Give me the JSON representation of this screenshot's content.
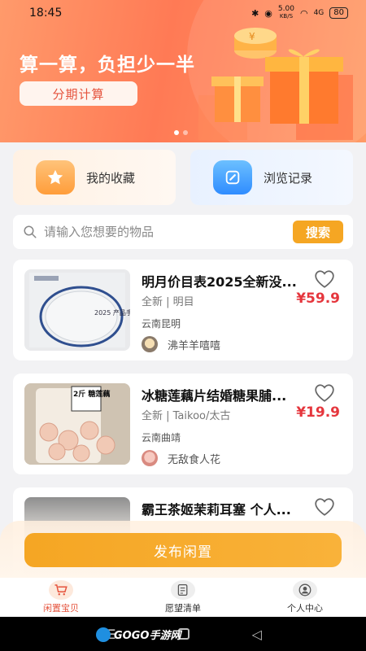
{
  "status_bar": {
    "time": "18:45",
    "network_speed": "5.00",
    "network_unit": "KB/S",
    "signal": "4G",
    "battery": "80"
  },
  "banner": {
    "headline": "算一算，负担少一半",
    "button_label": "分期计算"
  },
  "quick_actions": [
    {
      "label": "我的收藏",
      "icon": "star-bookmark-icon"
    },
    {
      "label": "浏览记录",
      "icon": "pencil-clock-icon"
    }
  ],
  "search": {
    "placeholder": "请输入您想要的物品",
    "button_label": "搜索"
  },
  "products": [
    {
      "title": "明月价目表2025全新没...",
      "meta": "全新 | 明目",
      "price": "¥59.9",
      "location": "云南昆明",
      "seller": "沸羊羊嘻嘻",
      "thumb_caption": "2025 产品手册"
    },
    {
      "title": "冰糖莲藕片结婚糖果脯...",
      "meta": "全新 | Taikoo/太古",
      "price": "¥19.9",
      "location": "云南曲靖",
      "seller": "无敌食人花",
      "thumb_caption": "2斤 糖莲藕"
    },
    {
      "title": "霸王茶姬茉莉耳塞 个人...",
      "meta": "",
      "price": "",
      "location": "",
      "seller": ""
    }
  ],
  "publish_button": "发布闲置",
  "tabs": [
    {
      "label": "闲置宝贝",
      "icon": "cart-icon",
      "active": true
    },
    {
      "label": "愿望清单",
      "icon": "list-icon",
      "active": false
    },
    {
      "label": "个人中心",
      "icon": "user-icon",
      "active": false
    }
  ],
  "watermark": "GOGO手游网",
  "colors": {
    "accent": "#f5a623",
    "price": "#e5363d",
    "banner": "#ff7a55"
  }
}
